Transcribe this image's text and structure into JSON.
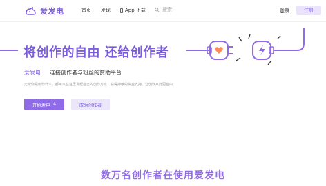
{
  "header": {
    "logo_text": "爱发电",
    "nav": {
      "home": "首页",
      "discover": "发现",
      "app_download": "App 下载"
    },
    "search_placeholder": "搜索",
    "login": "登录",
    "register": "注册"
  },
  "hero": {
    "title": "将创作的自由 还给创作者",
    "brand": "爱发电",
    "tagline": "连接创作者与粉丝的赞助平台",
    "description": "无论你是创作什么，都可以在这里发起自己的创作方案，获得持续的资金支持，让创作从此更自由",
    "start_button": "开始发电",
    "become_creator_button": "成为创作者"
  },
  "stats": {
    "title": "数万名创作者在使用爱发电"
  },
  "colors": {
    "accent": "#7a5cdc",
    "accent_light": "#ece6fb",
    "plug_heart": "#ff8a5b"
  },
  "icons": {
    "logo": "cat-logo-icon",
    "app": "phone-icon",
    "search": "search-icon",
    "start": "lightning-icon",
    "hero_plug": "plug-socket-illustration"
  }
}
